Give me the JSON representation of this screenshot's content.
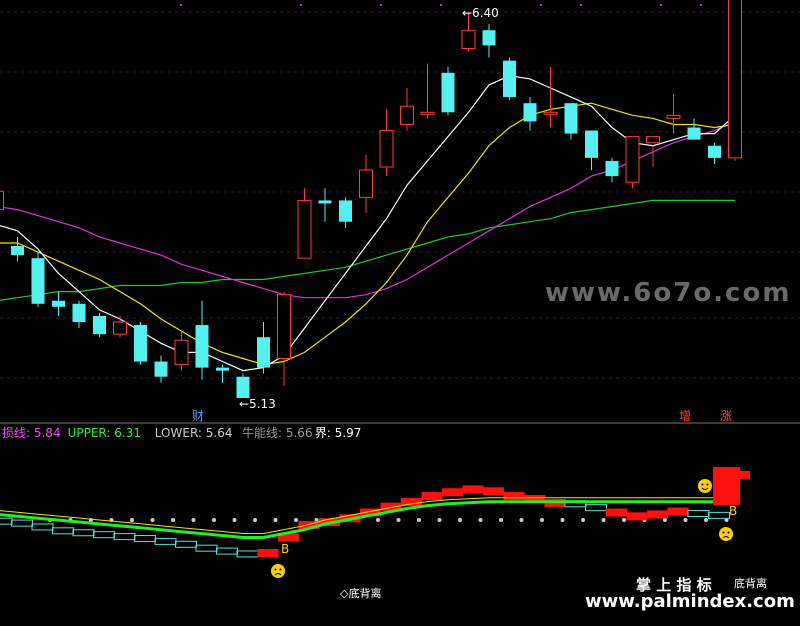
{
  "chart_data": {
    "type": "candlestick",
    "colors": {
      "up": "#ff3b3b",
      "down": "#55f0f0",
      "ma5": "#ffffff",
      "ma10": "#e8e800",
      "ma20": "#dd33dd",
      "ma60": "#22cc22",
      "bg": "#000000"
    },
    "upper_panel": {
      "candles": [
        {
          "o": 5.75,
          "c": 5.81,
          "h": 5.82,
          "l": 5.72
        },
        {
          "o": 5.63,
          "c": 5.6,
          "h": 5.66,
          "l": 5.58
        },
        {
          "o": 5.59,
          "c": 5.44,
          "h": 5.61,
          "l": 5.43
        },
        {
          "o": 5.45,
          "c": 5.43,
          "h": 5.48,
          "l": 5.4
        },
        {
          "o": 5.44,
          "c": 5.38,
          "h": 5.45,
          "l": 5.36
        },
        {
          "o": 5.4,
          "c": 5.34,
          "h": 5.41,
          "l": 5.33
        },
        {
          "o": 5.34,
          "c": 5.38,
          "h": 5.4,
          "l": 5.33
        },
        {
          "o": 5.37,
          "c": 5.25,
          "h": 5.38,
          "l": 5.24
        },
        {
          "o": 5.25,
          "c": 5.2,
          "h": 5.27,
          "l": 5.18
        },
        {
          "o": 5.24,
          "c": 5.32,
          "h": 5.35,
          "l": 5.22
        },
        {
          "o": 5.37,
          "c": 5.23,
          "h": 5.45,
          "l": 5.19
        },
        {
          "o": 5.23,
          "c": 5.22,
          "h": 5.24,
          "l": 5.18
        },
        {
          "o": 5.2,
          "c": 5.13,
          "h": 5.21,
          "l": 5.13
        },
        {
          "o": 5.33,
          "c": 5.23,
          "h": 5.38,
          "l": 5.21
        },
        {
          "o": 5.26,
          "c": 5.47,
          "h": 5.48,
          "l": 5.17
        },
        {
          "o": 5.59,
          "c": 5.78,
          "h": 5.82,
          "l": 5.59
        },
        {
          "o": 5.78,
          "c": 5.77,
          "h": 5.82,
          "l": 5.71
        },
        {
          "o": 5.78,
          "c": 5.71,
          "h": 5.79,
          "l": 5.69
        },
        {
          "o": 5.79,
          "c": 5.88,
          "h": 5.93,
          "l": 5.74
        },
        {
          "o": 5.89,
          "c": 6.01,
          "h": 6.08,
          "l": 5.86
        },
        {
          "o": 6.03,
          "c": 6.09,
          "h": 6.15,
          "l": 6.01
        },
        {
          "o": 6.07,
          "c": 6.07,
          "h": 6.23,
          "l": 6.05
        },
        {
          "o": 6.2,
          "c": 6.07,
          "h": 6.22,
          "l": 6.06
        },
        {
          "o": 6.28,
          "c": 6.34,
          "h": 6.4,
          "l": 6.27
        },
        {
          "o": 6.34,
          "c": 6.29,
          "h": 6.36,
          "l": 6.25
        },
        {
          "o": 6.24,
          "c": 6.12,
          "h": 6.25,
          "l": 6.11
        },
        {
          "o": 6.1,
          "c": 6.04,
          "h": 6.12,
          "l": 6.01
        },
        {
          "o": 6.07,
          "c": 6.07,
          "h": 6.22,
          "l": 6.02
        },
        {
          "o": 6.1,
          "c": 6.0,
          "h": 6.1,
          "l": 5.98
        },
        {
          "o": 6.01,
          "c": 5.92,
          "h": 6.0,
          "l": 5.88
        },
        {
          "o": 5.91,
          "c": 5.86,
          "h": 5.92,
          "l": 5.84
        },
        {
          "o": 5.84,
          "c": 5.99,
          "h": 5.99,
          "l": 5.82
        },
        {
          "o": 5.97,
          "c": 5.99,
          "h": 5.96,
          "l": 5.89
        },
        {
          "o": 6.05,
          "c": 6.06,
          "h": 6.13,
          "l": 6.0
        },
        {
          "o": 6.02,
          "c": 5.98,
          "h": 6.05,
          "l": 5.98
        },
        {
          "o": 5.96,
          "c": 5.92,
          "h": 5.97,
          "l": 5.9
        },
        {
          "o": 5.92,
          "c": 6.49,
          "h": 6.52,
          "l": 5.91
        }
      ],
      "ma5": [
        5.7,
        5.68,
        5.62,
        5.54,
        5.48,
        5.42,
        5.39,
        5.35,
        5.31,
        5.28,
        5.28,
        5.25,
        5.22,
        5.23,
        5.27,
        5.36,
        5.45,
        5.54,
        5.63,
        5.72,
        5.83,
        5.91,
        5.99,
        6.07,
        6.16,
        6.19,
        6.18,
        6.15,
        6.12,
        6.09,
        6.02,
        5.97,
        5.96,
        5.98,
        6.0,
        6.0,
        6.06
      ],
      "ma10": [
        5.64,
        5.64,
        5.61,
        5.58,
        5.55,
        5.52,
        5.48,
        5.44,
        5.39,
        5.35,
        5.31,
        5.28,
        5.26,
        5.24,
        5.25,
        5.28,
        5.33,
        5.38,
        5.44,
        5.51,
        5.6,
        5.71,
        5.79,
        5.87,
        5.96,
        6.02,
        6.06,
        6.08,
        6.09,
        6.1,
        6.08,
        6.06,
        6.05,
        6.03,
        6.03,
        6.02,
        6.03
      ],
      "ma20": [
        5.76,
        5.75,
        5.73,
        5.71,
        5.69,
        5.66,
        5.64,
        5.62,
        5.6,
        5.57,
        5.55,
        5.53,
        5.51,
        5.49,
        5.47,
        5.46,
        5.46,
        5.46,
        5.47,
        5.49,
        5.52,
        5.56,
        5.6,
        5.64,
        5.68,
        5.72,
        5.76,
        5.79,
        5.82,
        5.86,
        5.88,
        5.91,
        5.94,
        5.97,
        5.99,
        6.01,
        6.04
      ],
      "ma60": [
        5.45,
        5.46,
        5.47,
        5.48,
        5.48,
        5.49,
        5.5,
        5.5,
        5.5,
        5.51,
        5.51,
        5.52,
        5.52,
        5.52,
        5.53,
        5.54,
        5.55,
        5.56,
        5.58,
        5.6,
        5.62,
        5.64,
        5.66,
        5.67,
        5.69,
        5.7,
        5.71,
        5.72,
        5.74,
        5.75,
        5.76,
        5.77,
        5.78,
        5.78,
        5.78,
        5.78,
        5.78
      ],
      "annotations": {
        "high": "6.40",
        "low": "5.13",
        "tag_left": "财",
        "tag_zeng": "增",
        "tag_zhang": "涨"
      }
    },
    "lower_panel": {
      "legend": [
        {
          "text": "损线: 5.84",
          "color": "#ff44ff"
        },
        {
          "text": "UPPER: 6.31",
          "color": "#33ee33"
        },
        {
          "text": "LOWER: 5.64",
          "color": "#cccccc"
        },
        {
          "text": "牛能线: 5.66",
          "color": "#999999"
        },
        {
          "text": "界: 5.97",
          "color": "#ffffff"
        }
      ],
      "steps": [
        5.78,
        5.76,
        5.72,
        5.68,
        5.66,
        5.64,
        5.62,
        5.6,
        5.57,
        5.54,
        5.5,
        5.47,
        5.44,
        5.46,
        5.62,
        5.75,
        5.78,
        5.82,
        5.88,
        5.94,
        5.99,
        6.05,
        6.09,
        6.12,
        6.1,
        6.05,
        6.02,
        5.98,
        5.96,
        5.92,
        5.88,
        5.84,
        5.86,
        5.89,
        5.86,
        5.84,
        6.27
      ],
      "step_state": [
        "d",
        "d",
        "d",
        "d",
        "d",
        "d",
        "d",
        "d",
        "d",
        "d",
        "d",
        "d",
        "d",
        "u",
        "u",
        "u",
        "u",
        "u",
        "u",
        "u",
        "u",
        "u",
        "u",
        "u",
        "u",
        "u",
        "u",
        "u",
        "d",
        "d",
        "u",
        "u",
        "u",
        "u",
        "d",
        "d",
        "u"
      ],
      "bull_line": [
        5.82,
        5.8,
        5.78,
        5.76,
        5.74,
        5.72,
        5.7,
        5.68,
        5.66,
        5.64,
        5.62,
        5.6,
        5.58,
        5.58,
        5.62,
        5.66,
        5.72,
        5.76,
        5.8,
        5.84,
        5.88,
        5.91,
        5.93,
        5.94,
        5.95,
        5.95,
        5.95,
        5.95,
        5.95,
        5.95,
        5.95,
        5.95,
        5.95,
        5.95,
        5.95,
        5.95,
        5.95
      ],
      "signals": {
        "buy_label": "B",
        "divergence_label": "◇底背离",
        "divergence_right": "底背离"
      }
    },
    "watermarks": {
      "site_top": "www.6o7o.com",
      "brand_cn": "掌 上 指 标",
      "site_bottom": "www.palmindex.com"
    }
  }
}
